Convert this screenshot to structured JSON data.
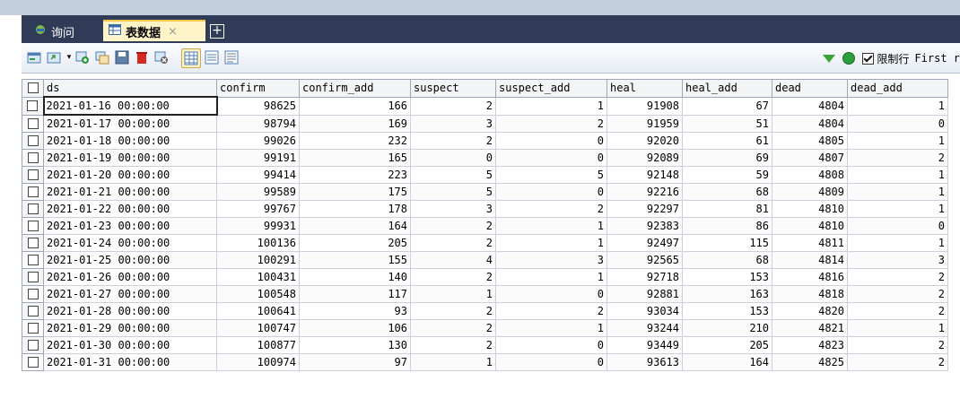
{
  "tabs": [
    {
      "label": "询问",
      "icon": "query-icon",
      "active": false
    },
    {
      "label": "表数据",
      "icon": "table-icon",
      "active": true
    }
  ],
  "add_tab_label": "+",
  "close_label": "×",
  "toolbar": {
    "limit_label": "限制行",
    "limit_checked": true,
    "first_label": "First r"
  },
  "table": {
    "columns": [
      "ds",
      "confirm",
      "confirm_add",
      "suspect",
      "suspect_add",
      "heal",
      "heal_add",
      "dead",
      "dead_add"
    ],
    "rows": [
      [
        "2021-01-16 00:00:00",
        "98625",
        "166",
        "2",
        "1",
        "91908",
        "67",
        "4804",
        "1"
      ],
      [
        "2021-01-17 00:00:00",
        "98794",
        "169",
        "3",
        "2",
        "91959",
        "51",
        "4804",
        "0"
      ],
      [
        "2021-01-18 00:00:00",
        "99026",
        "232",
        "2",
        "0",
        "92020",
        "61",
        "4805",
        "1"
      ],
      [
        "2021-01-19 00:00:00",
        "99191",
        "165",
        "0",
        "0",
        "92089",
        "69",
        "4807",
        "2"
      ],
      [
        "2021-01-20 00:00:00",
        "99414",
        "223",
        "5",
        "5",
        "92148",
        "59",
        "4808",
        "1"
      ],
      [
        "2021-01-21 00:00:00",
        "99589",
        "175",
        "5",
        "0",
        "92216",
        "68",
        "4809",
        "1"
      ],
      [
        "2021-01-22 00:00:00",
        "99767",
        "178",
        "3",
        "2",
        "92297",
        "81",
        "4810",
        "1"
      ],
      [
        "2021-01-23 00:00:00",
        "99931",
        "164",
        "2",
        "1",
        "92383",
        "86",
        "4810",
        "0"
      ],
      [
        "2021-01-24 00:00:00",
        "100136",
        "205",
        "2",
        "1",
        "92497",
        "115",
        "4811",
        "1"
      ],
      [
        "2021-01-25 00:00:00",
        "100291",
        "155",
        "4",
        "3",
        "92565",
        "68",
        "4814",
        "3"
      ],
      [
        "2021-01-26 00:00:00",
        "100431",
        "140",
        "2",
        "1",
        "92718",
        "153",
        "4816",
        "2"
      ],
      [
        "2021-01-27 00:00:00",
        "100548",
        "117",
        "1",
        "0",
        "92881",
        "163",
        "4818",
        "2"
      ],
      [
        "2021-01-28 00:00:00",
        "100641",
        "93",
        "2",
        "2",
        "93034",
        "153",
        "4820",
        "2"
      ],
      [
        "2021-01-29 00:00:00",
        "100747",
        "106",
        "2",
        "1",
        "93244",
        "210",
        "4821",
        "1"
      ],
      [
        "2021-01-30 00:00:00",
        "100877",
        "130",
        "2",
        "0",
        "93449",
        "205",
        "4823",
        "2"
      ],
      [
        "2021-01-31 00:00:00",
        "100974",
        "97",
        "1",
        "0",
        "93613",
        "164",
        "4825",
        "2"
      ]
    ]
  }
}
